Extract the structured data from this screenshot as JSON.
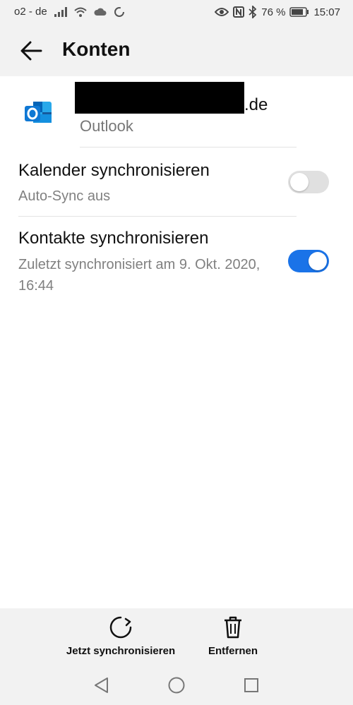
{
  "status_bar": {
    "carrier": "o2 - de",
    "battery_percent": "76 %",
    "time": "15:07",
    "icons": [
      "signal-icon",
      "wifi-icon",
      "cloud-icon",
      "sync-status-icon",
      "eye-icon",
      "nfc-icon",
      "bluetooth-icon",
      "battery-icon"
    ]
  },
  "header": {
    "back_icon": "arrow-left-icon",
    "title": "Konten"
  },
  "account": {
    "logo_icon": "outlook-icon",
    "email_visible_suffix": ".de",
    "type": "Outlook"
  },
  "sync_items": [
    {
      "title": "Kalender synchronisieren",
      "subtitle": "Auto-Sync aus",
      "enabled": false
    },
    {
      "title": "Kontakte synchronisieren",
      "subtitle": "Zuletzt synchronisiert am 9. Okt. 2020, 16:44",
      "enabled": true
    }
  ],
  "actions": {
    "sync_now_label": "Jetzt synchronisieren",
    "remove_label": "Entfernen"
  },
  "colors": {
    "accent": "#1a73e8",
    "toggle_off": "#e0e0e0",
    "bar_background": "#f2f2f2"
  }
}
